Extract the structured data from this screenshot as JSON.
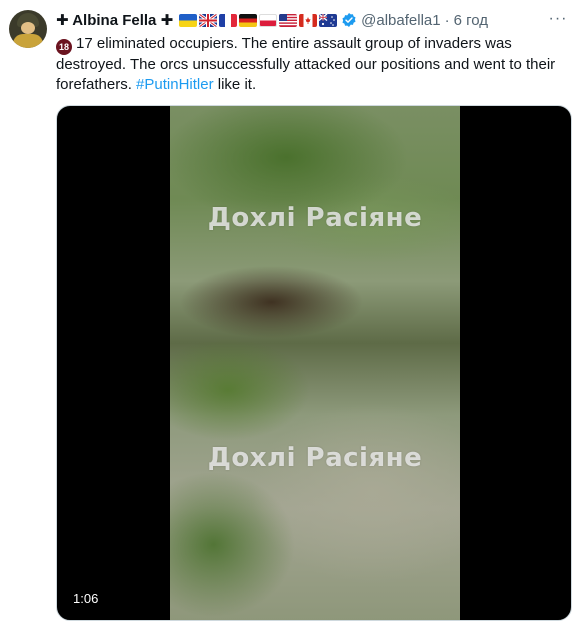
{
  "tweet": {
    "author_name": "Albina Fella",
    "cross_prefix": "✚",
    "cross_suffix": "✚",
    "flags": [
      "ukraine-flag-icon",
      "uk-flag-icon",
      "france-flag-icon",
      "germany-flag-icon",
      "poland-flag-icon",
      "usa-flag-icon",
      "canada-flag-icon",
      "australia-flag-icon"
    ],
    "handle": "@albafella1",
    "separator": "·",
    "time": "6 год",
    "text_line": "17 eliminated occupiers. The entire assault group of invaders was destroyed. The orcs unsuccessfully attacked our positions and went to their forefathers.",
    "hashtag": "#PutinHitler",
    "text_suffix": "like it.",
    "badge": "18",
    "more_label": "···"
  },
  "media": {
    "watermark_1": "Дохлі Расіяне",
    "watermark_2": "Дохлі Расіяне",
    "duration": "1:06"
  },
  "colors": {
    "link": "#1d9bf0",
    "secondary_text": "#536471",
    "verified": "#1d9bf0"
  }
}
